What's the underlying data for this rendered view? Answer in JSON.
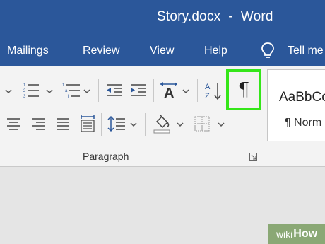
{
  "window": {
    "title": "Story.docx  -  Word"
  },
  "tabs": [
    {
      "label": "Mailings"
    },
    {
      "label": "Review"
    },
    {
      "label": "View"
    },
    {
      "label": "Help"
    },
    {
      "label": "Tell me"
    }
  ],
  "ribbon": {
    "group_label": "Paragraph",
    "show_hide_symbol": "¶",
    "styles": {
      "preview": "AaBbCc",
      "name": "¶ Norm"
    }
  },
  "watermark": {
    "prefix": "wiki",
    "suffix": "How"
  },
  "colors": {
    "title_bar": "#2b579a",
    "highlight_border": "#35e619",
    "watermark_bg": "#8aa875"
  }
}
